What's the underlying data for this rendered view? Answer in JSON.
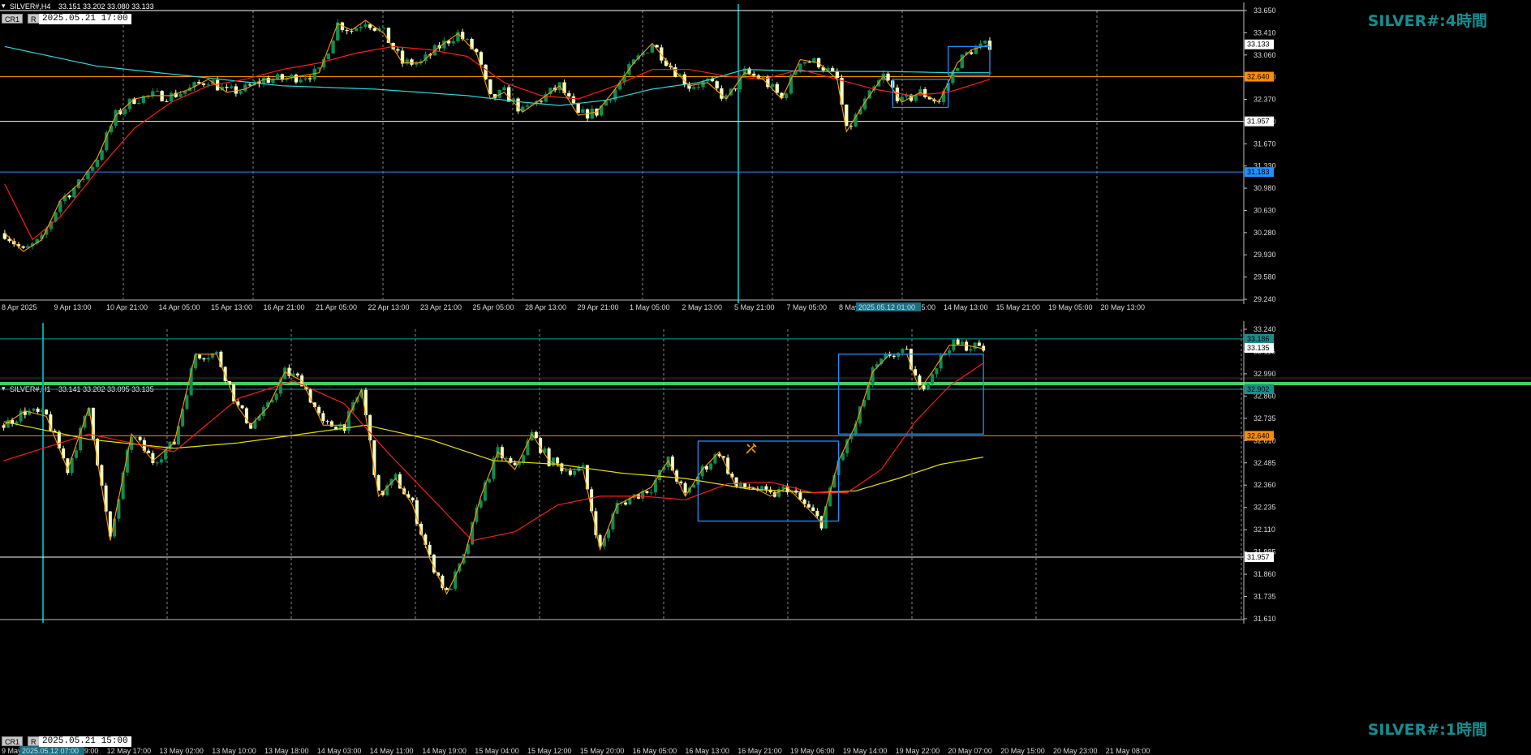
{
  "colors": {
    "background": "#000000",
    "bull": "#0b8f54",
    "bear": "#f4ffc0",
    "ema_fast": "#ff1a1a",
    "ema_slow_top": "#2ad8e0",
    "ema_slow_bottom": "#e8e000",
    "zigzag": "#ff9900",
    "box": "#1e90ff",
    "level_orange": "#ff8c00",
    "level_white": "#ffffff",
    "level_blue": "#1e90ff",
    "cyan_line": "#00a0a0",
    "watermark": "#138f92"
  },
  "icons": {
    "drawing_tool": "pencil-cross-icon"
  },
  "chart_data": [
    {
      "type": "candlestick",
      "symbol_header": "SILVER#,H4",
      "ohlc_header": "33.151 33.202 33.080 33.133",
      "title": "SILVER#:4時間",
      "datetime_box": "2025.05.21 17:00",
      "button_cr": "CR1",
      "button_r": "R",
      "ylim": [
        29.24,
        33.65
      ],
      "yticks": [
        "33.650",
        "33.410",
        "33.060",
        "32.710",
        "32.370",
        "32.020",
        "31.670",
        "31.330",
        "30.980",
        "30.630",
        "30.280",
        "29.930",
        "29.580",
        "29.240"
      ],
      "price_labels": [
        {
          "value": 33.133,
          "text": "33.133",
          "kind": "current"
        },
        {
          "value": 32.64,
          "text": "32.640",
          "kind": "orange"
        },
        {
          "value": 31.957,
          "text": "31.957",
          "kind": "white"
        },
        {
          "value": 31.183,
          "text": "31.183",
          "kind": "blue"
        }
      ],
      "levels": [
        {
          "value": 33.65,
          "color": "white"
        },
        {
          "value": 32.64,
          "color": "orange"
        },
        {
          "value": 31.957,
          "color": "white"
        },
        {
          "value": 31.183,
          "color": "blue"
        }
      ],
      "xticks": [
        "8 Apr 2025",
        "9 Apr 13:00",
        "10 Apr 21:00",
        "14 Apr 05:00",
        "15 Apr 13:00",
        "16 Apr 21:00",
        "21 Apr 05:00",
        "22 Apr 13:00",
        "23 Apr 21:00",
        "25 Apr 05:00",
        "28 Apr 13:00",
        "29 Apr 21:00",
        "1 May 05:00",
        "2 May 13:00",
        "5 May 21:00",
        "7 May 05:00",
        "8 May 13:00",
        "13 May 05:00",
        "14 May 13:00",
        "15 May 21:00",
        "19 May 05:00",
        "20 May 13:00"
      ],
      "x_highlight": "2025.05.12 01:00",
      "boxes": [
        {
          "from_bar": 192,
          "to_bar": 204,
          "hi": 32.6,
          "lo": 32.17
        },
        {
          "from_bar": 204,
          "to_bar": 213,
          "hi": 33.1,
          "lo": 32.66
        }
      ],
      "waypoints": [
        [
          0,
          30.25
        ],
        [
          4,
          29.97
        ],
        [
          8,
          30.15
        ],
        [
          12,
          30.75
        ],
        [
          16,
          31.0
        ],
        [
          20,
          31.4
        ],
        [
          24,
          32.05
        ],
        [
          28,
          32.3
        ],
        [
          32,
          32.35
        ],
        [
          36,
          32.35
        ],
        [
          40,
          32.45
        ],
        [
          44,
          32.6
        ],
        [
          48,
          32.4
        ],
        [
          52,
          32.45
        ],
        [
          56,
          32.6
        ],
        [
          60,
          32.6
        ],
        [
          64,
          32.65
        ],
        [
          68,
          32.7
        ],
        [
          72,
          33.45
        ],
        [
          75,
          33.35
        ],
        [
          78,
          33.5
        ],
        [
          82,
          33.3
        ],
        [
          86,
          32.85
        ],
        [
          90,
          32.85
        ],
        [
          94,
          33.1
        ],
        [
          98,
          33.3
        ],
        [
          102,
          33.0
        ],
        [
          105,
          32.3
        ],
        [
          108,
          32.4
        ],
        [
          112,
          32.1
        ],
        [
          116,
          32.3
        ],
        [
          120,
          32.5
        ],
        [
          124,
          32.05
        ],
        [
          128,
          32.1
        ],
        [
          132,
          32.45
        ],
        [
          136,
          32.85
        ],
        [
          140,
          33.15
        ],
        [
          144,
          32.8
        ],
        [
          148,
          32.5
        ],
        [
          152,
          32.55
        ],
        [
          156,
          32.3
        ],
        [
          160,
          32.7
        ],
        [
          164,
          32.6
        ],
        [
          168,
          32.3
        ],
        [
          172,
          32.9
        ],
        [
          176,
          32.85
        ],
        [
          180,
          32.6
        ],
        [
          182,
          31.8
        ],
        [
          186,
          32.25
        ],
        [
          190,
          32.65
        ],
        [
          194,
          32.25
        ],
        [
          198,
          32.4
        ],
        [
          202,
          32.25
        ],
        [
          206,
          32.85
        ],
        [
          209,
          33.05
        ],
        [
          213,
          33.13
        ]
      ],
      "ema_fast_waypoints": [
        [
          0,
          31.0
        ],
        [
          6,
          30.15
        ],
        [
          12,
          30.5
        ],
        [
          20,
          31.2
        ],
        [
          28,
          31.85
        ],
        [
          36,
          32.25
        ],
        [
          44,
          32.5
        ],
        [
          52,
          32.6
        ],
        [
          60,
          32.75
        ],
        [
          68,
          32.85
        ],
        [
          76,
          33.0
        ],
        [
          84,
          33.1
        ],
        [
          92,
          33.05
        ],
        [
          100,
          32.95
        ],
        [
          108,
          32.55
        ],
        [
          116,
          32.35
        ],
        [
          124,
          32.3
        ],
        [
          132,
          32.5
        ],
        [
          140,
          32.75
        ],
        [
          148,
          32.75
        ],
        [
          156,
          32.65
        ],
        [
          164,
          32.6
        ],
        [
          172,
          32.75
        ],
        [
          180,
          32.6
        ],
        [
          188,
          32.45
        ],
        [
          196,
          32.35
        ],
        [
          204,
          32.4
        ],
        [
          213,
          32.6
        ]
      ],
      "ema_slow_waypoints": [
        [
          0,
          33.1
        ],
        [
          20,
          32.8
        ],
        [
          40,
          32.65
        ],
        [
          60,
          32.5
        ],
        [
          80,
          32.45
        ],
        [
          100,
          32.35
        ],
        [
          112,
          32.25
        ],
        [
          120,
          32.2
        ],
        [
          130,
          32.28
        ],
        [
          140,
          32.45
        ],
        [
          150,
          32.55
        ],
        [
          160,
          32.75
        ],
        [
          175,
          32.72
        ],
        [
          190,
          32.72
        ],
        [
          205,
          32.7
        ],
        [
          213,
          32.7
        ]
      ]
    },
    {
      "type": "candlestick",
      "symbol_header": "SILVER#,H1",
      "ohlc_header": "33.141 33.202 33.095 33.135",
      "title": "SILVER#:1時間",
      "datetime_box": "2025.05.21 15:00",
      "button_cr": "CR1",
      "button_r": "R",
      "ylim": [
        31.61,
        33.24
      ],
      "yticks": [
        "33.240",
        "33.115",
        "32.990",
        "32.860",
        "32.735",
        "32.610",
        "32.485",
        "32.360",
        "32.235",
        "32.110",
        "31.985",
        "31.860",
        "31.735",
        "31.610"
      ],
      "price_labels": [
        {
          "value": 33.186,
          "text": "33.186",
          "kind": "cyan"
        },
        {
          "value": 33.135,
          "text": "33.135",
          "kind": "current"
        },
        {
          "value": 32.902,
          "text": "32.902",
          "kind": "cyan"
        },
        {
          "value": 32.64,
          "text": "32.640",
          "kind": "orange"
        },
        {
          "value": 31.957,
          "text": "31.957",
          "kind": "white"
        }
      ],
      "levels": [
        {
          "value": 33.186,
          "color": "cyan"
        },
        {
          "value": 32.902,
          "color": "cyan"
        },
        {
          "value": 32.64,
          "color": "orange"
        },
        {
          "value": 31.957,
          "color": "white"
        }
      ],
      "xticks": [
        "9 May 2025",
        "12 May 09:00",
        "12 May 17:00",
        "13 May 02:00",
        "13 May 10:00",
        "13 May 18:00",
        "14 May 03:00",
        "14 May 11:00",
        "14 May 19:00",
        "15 May 04:00",
        "15 May 12:00",
        "15 May 20:00",
        "16 May 05:00",
        "16 May 13:00",
        "16 May 21:00",
        "19 May 06:00",
        "19 May 14:00",
        "19 May 22:00",
        "20 May 07:00",
        "20 May 15:00",
        "20 May 23:00",
        "21 May 08:00"
      ],
      "x_highlight": "2025.05.12 07:00",
      "boxes": [
        {
          "from_bar": 163,
          "to_bar": 196,
          "hi": 32.61,
          "lo": 32.16
        },
        {
          "from_bar": 196,
          "to_bar": 230,
          "hi": 33.1,
          "lo": 32.65
        }
      ],
      "waypoints": [
        [
          0,
          32.7
        ],
        [
          5,
          32.78
        ],
        [
          10,
          32.75
        ],
        [
          15,
          32.45
        ],
        [
          20,
          32.8
        ],
        [
          25,
          32.05
        ],
        [
          30,
          32.65
        ],
        [
          35,
          32.5
        ],
        [
          40,
          32.6
        ],
        [
          45,
          33.1
        ],
        [
          50,
          33.1
        ],
        [
          55,
          32.8
        ],
        [
          58,
          32.7
        ],
        [
          62,
          32.8
        ],
        [
          66,
          33.0
        ],
        [
          70,
          32.95
        ],
        [
          75,
          32.7
        ],
        [
          80,
          32.7
        ],
        [
          84,
          32.9
        ],
        [
          88,
          32.3
        ],
        [
          92,
          32.4
        ],
        [
          96,
          32.25
        ],
        [
          100,
          31.95
        ],
        [
          104,
          31.75
        ],
        [
          108,
          31.95
        ],
        [
          112,
          32.3
        ],
        [
          116,
          32.55
        ],
        [
          120,
          32.45
        ],
        [
          124,
          32.65
        ],
        [
          128,
          32.5
        ],
        [
          132,
          32.45
        ],
        [
          136,
          32.45
        ],
        [
          140,
          32.0
        ],
        [
          144,
          32.25
        ],
        [
          148,
          32.3
        ],
        [
          152,
          32.35
        ],
        [
          156,
          32.5
        ],
        [
          160,
          32.3
        ],
        [
          164,
          32.45
        ],
        [
          168,
          32.55
        ],
        [
          172,
          32.35
        ],
        [
          176,
          32.35
        ],
        [
          180,
          32.3
        ],
        [
          184,
          32.35
        ],
        [
          188,
          32.25
        ],
        [
          192,
          32.15
        ],
        [
          196,
          32.5
        ],
        [
          200,
          32.7
        ],
        [
          204,
          33.0
        ],
        [
          208,
          33.1
        ],
        [
          212,
          33.1
        ],
        [
          215,
          32.9
        ],
        [
          218,
          33.0
        ],
        [
          222,
          33.15
        ],
        [
          226,
          33.15
        ],
        [
          230,
          33.13
        ]
      ],
      "ema_fast_waypoints": [
        [
          0,
          32.5
        ],
        [
          20,
          32.65
        ],
        [
          40,
          32.55
        ],
        [
          55,
          32.85
        ],
        [
          68,
          32.95
        ],
        [
          80,
          32.82
        ],
        [
          90,
          32.55
        ],
        [
          100,
          32.3
        ],
        [
          110,
          32.05
        ],
        [
          120,
          32.1
        ],
        [
          130,
          32.25
        ],
        [
          140,
          32.3
        ],
        [
          150,
          32.3
        ],
        [
          160,
          32.28
        ],
        [
          170,
          32.37
        ],
        [
          180,
          32.38
        ],
        [
          190,
          32.32
        ],
        [
          198,
          32.32
        ],
        [
          206,
          32.45
        ],
        [
          214,
          32.72
        ],
        [
          222,
          32.92
        ],
        [
          230,
          33.05
        ]
      ],
      "ema_slow_waypoints": [
        [
          0,
          32.72
        ],
        [
          20,
          32.62
        ],
        [
          40,
          32.57
        ],
        [
          55,
          32.6
        ],
        [
          70,
          32.65
        ],
        [
          85,
          32.7
        ],
        [
          100,
          32.62
        ],
        [
          115,
          32.5
        ],
        [
          130,
          32.48
        ],
        [
          145,
          32.43
        ],
        [
          160,
          32.4
        ],
        [
          175,
          32.34
        ],
        [
          190,
          32.32
        ],
        [
          200,
          32.33
        ],
        [
          210,
          32.4
        ],
        [
          220,
          32.48
        ],
        [
          230,
          32.52
        ]
      ]
    }
  ]
}
